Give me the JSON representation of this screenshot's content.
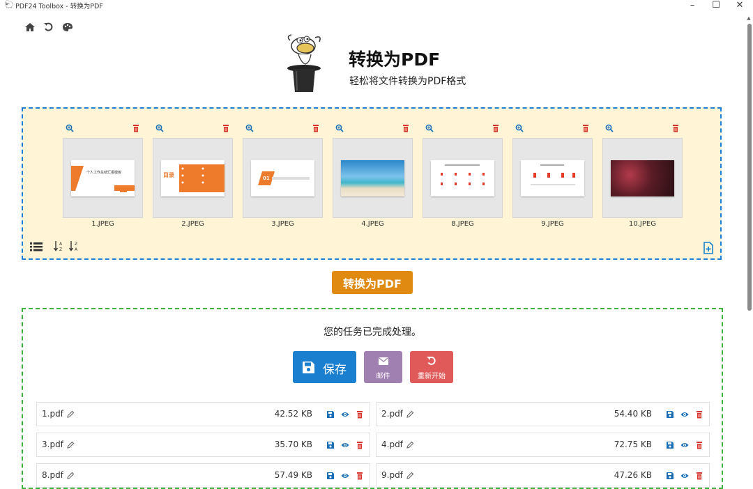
{
  "window": {
    "title": "PDF24 Toolbox - 转换为PDF"
  },
  "header": {
    "title": "转换为PDF",
    "subtitle": "轻松将文件转换为PDF格式"
  },
  "files": [
    {
      "name": "1.JPEG",
      "thumb_text": "个人工作总结汇报模板"
    },
    {
      "name": "2.JPEG",
      "thumb_text": "目录"
    },
    {
      "name": "3.JPEG",
      "thumb_text": "01"
    },
    {
      "name": "4.JPEG",
      "thumb_text": ""
    },
    {
      "name": "8.JPEG",
      "thumb_text": ""
    },
    {
      "name": "9.JPEG",
      "thumb_text": ""
    },
    {
      "name": "10.JPEG",
      "thumb_text": ""
    }
  ],
  "convert_button": "转换为PDF",
  "result": {
    "message": "您的任务已完成处理。",
    "save_label": "保存",
    "mail_label": "邮件",
    "restart_label": "重新开始"
  },
  "output_files": [
    {
      "name": "1.pdf",
      "size": "42.52 KB"
    },
    {
      "name": "2.pdf",
      "size": "54.40 KB"
    },
    {
      "name": "3.pdf",
      "size": "35.70 KB"
    },
    {
      "name": "4.pdf",
      "size": "72.75 KB"
    },
    {
      "name": "8.pdf",
      "size": "57.49 KB"
    },
    {
      "name": "9.pdf",
      "size": "47.26 KB"
    }
  ],
  "colors": {
    "accent_blue": "#1a7fcf",
    "convert_orange": "#e08a12",
    "delete_red": "#d9342b",
    "dropzone_bg": "#fff5d6"
  },
  "icons": [
    "home-icon",
    "undo-icon",
    "palette-icon",
    "zoom-icon",
    "trash-icon",
    "list-icon",
    "sort-asc-icon",
    "sort-desc-icon",
    "add-file-icon",
    "save-icon",
    "mail-icon",
    "restart-icon",
    "pencil-icon",
    "eye-icon"
  ]
}
